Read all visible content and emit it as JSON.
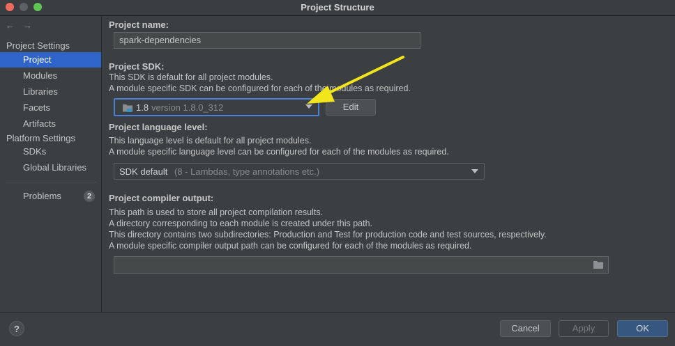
{
  "window": {
    "title": "Project Structure"
  },
  "sidebar": {
    "back": "←",
    "forward": "→",
    "project_settings_header": "Project Settings",
    "project_items": [
      {
        "label": "Project"
      },
      {
        "label": "Modules"
      },
      {
        "label": "Libraries"
      },
      {
        "label": "Facets"
      },
      {
        "label": "Artifacts"
      }
    ],
    "platform_settings_header": "Platform Settings",
    "platform_items": [
      {
        "label": "SDKs"
      },
      {
        "label": "Global Libraries"
      }
    ],
    "problems": {
      "label": "Problems",
      "count": "2"
    }
  },
  "main": {
    "project_name_label": "Project name:",
    "project_name_value": "spark-dependencies",
    "sdk_label": "Project SDK:",
    "sdk_desc1": "This SDK is default for all project modules.",
    "sdk_desc2": "A module specific SDK can be configured for each of the modules as required.",
    "sdk_version_main": "1.8",
    "sdk_version_detail": "version 1.8.0_312",
    "edit_button": "Edit",
    "lang_label": "Project language level:",
    "lang_desc1": "This language level is default for all project modules.",
    "lang_desc2": "A module specific language level can be configured for each of the modules as required.",
    "lang_value_main": "SDK default",
    "lang_value_detail": "(8 - Lambdas, type annotations etc.)",
    "compiler_label": "Project compiler output:",
    "compiler_desc1": "This path is used to store all project compilation results.",
    "compiler_desc2": "A directory corresponding to each module is created under this path.",
    "compiler_desc3": "This directory contains two subdirectories: Production and Test for production code and test sources, respectively.",
    "compiler_desc4": "A module specific compiler output path can be configured for each of the modules as required.",
    "compiler_value": ""
  },
  "footer": {
    "help": "?",
    "cancel": "Cancel",
    "apply": "Apply",
    "ok": "OK"
  },
  "colors": {
    "selection": "#2f65ca",
    "annotation_arrow": "#f2e51c"
  }
}
